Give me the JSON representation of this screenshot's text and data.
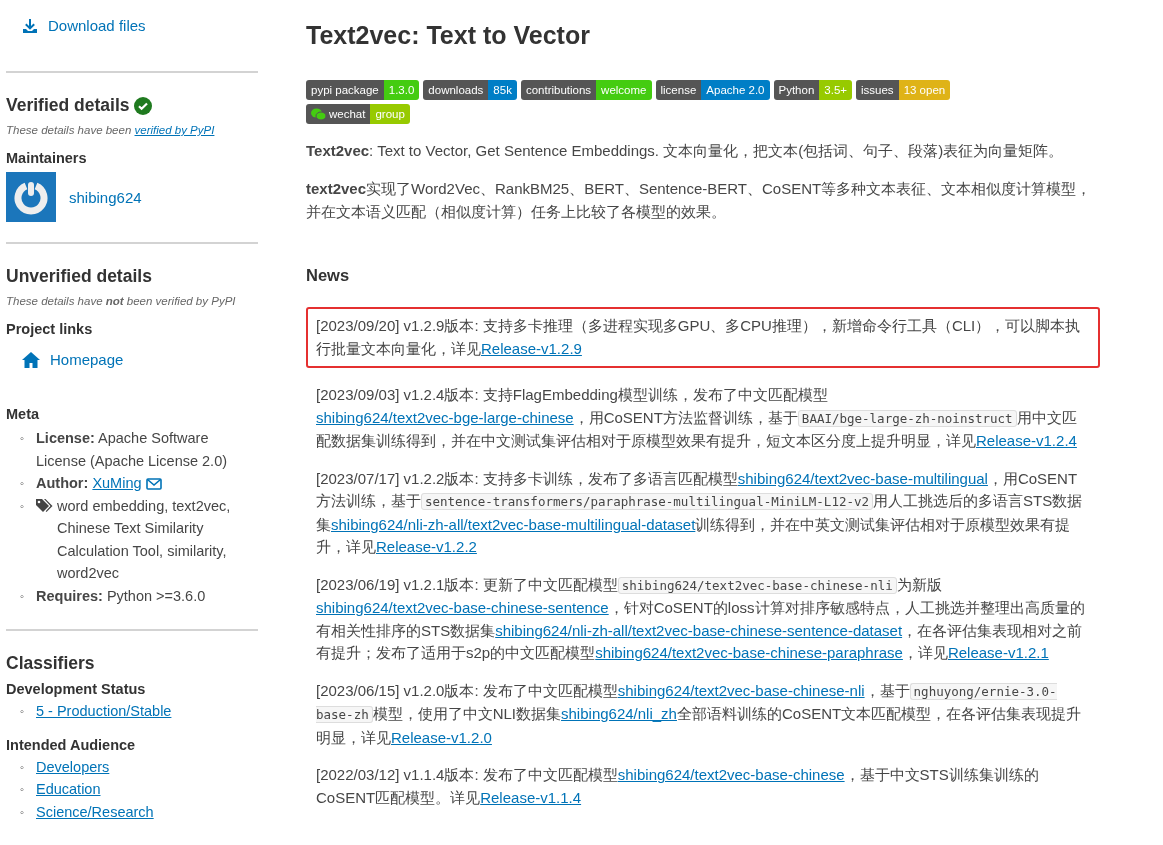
{
  "sidebar": {
    "download_link": "Download files",
    "verified": {
      "title": "Verified details",
      "note_text": "These details have been ",
      "note_link": "verified by PyPI",
      "maintainers_title": "Maintainers",
      "maintainers": [
        "shibing624"
      ]
    },
    "unverified": {
      "title": "Unverified details",
      "note": "These details have **not** been verified by PyPI",
      "project_links_title": "Project links",
      "project_links": [
        "Homepage"
      ],
      "meta_title": "Meta",
      "bullet": "◦",
      "meta": [
        {
          "kind": "text",
          "label": "License:",
          "value": "Apache Software License (Apache License 2.0)"
        },
        {
          "kind": "email_link",
          "label": "Author:",
          "value": "XuMing"
        },
        {
          "kind": "tags",
          "value": "word embedding, text2vec, Chinese Text Similarity Calculation Tool, similarity, word2vec"
        },
        {
          "kind": "text",
          "label": "Requires:",
          "value": "Python >=3.6.0"
        }
      ]
    },
    "classifiers": {
      "title": "Classifiers",
      "bullet": "◦",
      "groups": [
        {
          "name": "Development Status",
          "items": [
            "5 - Production/Stable"
          ]
        },
        {
          "name": "Intended Audience",
          "items": [
            "Developers",
            "Education",
            "Science/Research"
          ]
        }
      ]
    }
  },
  "main": {
    "title": "Text2vec: Text to Vector",
    "badges": [
      {
        "label": "pypi package",
        "value": "1.3.0",
        "color": "#4c1"
      },
      {
        "label": "downloads",
        "value": "85k",
        "color": "#007ec6"
      },
      {
        "label": "contributions",
        "value": "welcome",
        "color": "#4c1"
      },
      {
        "label": "license",
        "value": "Apache 2.0",
        "color": "#007ec6"
      },
      {
        "label": "Python",
        "value": "3.5+",
        "color": "#97ca00"
      },
      {
        "label": "issues",
        "value": "13 open",
        "color": "#dfb317"
      },
      {
        "label": "wechat",
        "value": "group",
        "color": "#97ca00"
      }
    ],
    "paragraphs": [
      "**Text2vec**: Text to Vector, Get Sentence Embeddings. 文本向量化，把文本(包括词、句子、段落)表征为向量矩阵。",
      "**text2vec**实现了Word2Vec、RankBM25、BERT、Sentence-BERT、CoSENT等多种文本表征、文本相似度计算模型，并在文本语义匹配（相似度计算）任务上比较了各模型的效果。"
    ],
    "news_title": "News",
    "news": [
      {
        "highlighted": true,
        "parts": [
          {
            "kind": "text",
            "text": "[2023/09/20] v1.2.9版本: 支持多卡推理（多进程实现多GPU、多CPU推理），新增命令行工具（CLI），可以脚本执行批量文本向量化，详见"
          },
          {
            "kind": "link",
            "text": "Release-v1.2.9"
          }
        ]
      },
      {
        "highlighted": false,
        "parts": [
          {
            "kind": "text",
            "text": "[2023/09/03] v1.2.4版本: 支持FlagEmbedding模型训练，发布了中文匹配模型"
          },
          {
            "kind": "link",
            "text": "shibing624/text2vec-bge-large-chinese"
          },
          {
            "kind": "text",
            "text": "，用CoSENT方法监督训练，基于"
          },
          {
            "kind": "code",
            "text": "BAAI/bge-large-zh-noinstruct"
          },
          {
            "kind": "text",
            "text": "用中文匹配数据集训练得到，并在中文测试集评估相对于原模型效果有提升，短文本区分度上提升明显，详见"
          },
          {
            "kind": "link",
            "text": "Release-v1.2.4"
          }
        ]
      },
      {
        "highlighted": false,
        "parts": [
          {
            "kind": "text",
            "text": "[2023/07/17] v1.2.2版本: 支持多卡训练，发布了多语言匹配模型"
          },
          {
            "kind": "link",
            "text": "shibing624/text2vec-base-multilingual"
          },
          {
            "kind": "text",
            "text": "，用CoSENT方法训练，基于"
          },
          {
            "kind": "code",
            "text": "sentence-transformers/paraphrase-multilingual-MiniLM-L12-v2"
          },
          {
            "kind": "text",
            "text": "用人工挑选后的多语言STS数据集"
          },
          {
            "kind": "link",
            "text": "shibing624/nli-zh-all/text2vec-base-multilingual-dataset"
          },
          {
            "kind": "text",
            "text": "训练得到，并在中英文测试集评估相对于原模型效果有提升，详见"
          },
          {
            "kind": "link",
            "text": "Release-v1.2.2"
          }
        ]
      },
      {
        "highlighted": false,
        "parts": [
          {
            "kind": "text",
            "text": "[2023/06/19] v1.2.1版本: 更新了中文匹配模型"
          },
          {
            "kind": "code",
            "text": "shibing624/text2vec-base-chinese-nli"
          },
          {
            "kind": "text",
            "text": "为新版"
          },
          {
            "kind": "link",
            "text": "shibing624/text2vec-base-chinese-sentence"
          },
          {
            "kind": "text",
            "text": "，针对CoSENT的loss计算对排序敏感特点，人工挑选并整理出高质量的有相关性排序的STS数据集"
          },
          {
            "kind": "link",
            "text": "shibing624/nli-zh-all/text2vec-base-chinese-sentence-dataset"
          },
          {
            "kind": "text",
            "text": "，在各评估集表现相对之前有提升；发布了适用于s2p的中文匹配模型"
          },
          {
            "kind": "link",
            "text": "shibing624/text2vec-base-chinese-paraphrase"
          },
          {
            "kind": "text",
            "text": "，详见"
          },
          {
            "kind": "link",
            "text": "Release-v1.2.1"
          }
        ]
      },
      {
        "highlighted": false,
        "parts": [
          {
            "kind": "text",
            "text": "[2023/06/15] v1.2.0版本: 发布了中文匹配模型"
          },
          {
            "kind": "link",
            "text": "shibing624/text2vec-base-chinese-nli"
          },
          {
            "kind": "text",
            "text": "，基于"
          },
          {
            "kind": "code",
            "text": "nghuyong/ernie-3.0-base-zh"
          },
          {
            "kind": "text",
            "text": "模型，使用了中文NLI数据集"
          },
          {
            "kind": "link",
            "text": "shibing624/nli_zh"
          },
          {
            "kind": "text",
            "text": "全部语料训练的CoSENT文本匹配模型，在各评估集表现提升明显，详见"
          },
          {
            "kind": "link",
            "text": "Release-v1.2.0"
          }
        ]
      },
      {
        "highlighted": false,
        "parts": [
          {
            "kind": "text",
            "text": "[2022/03/12] v1.1.4版本: 发布了中文匹配模型"
          },
          {
            "kind": "link",
            "text": "shibing624/text2vec-base-chinese"
          },
          {
            "kind": "text",
            "text": "，基于中文STS训练集训练的CoSENT匹配模型。详见"
          },
          {
            "kind": "link",
            "text": "Release-v1.1.4"
          }
        ]
      }
    ]
  }
}
